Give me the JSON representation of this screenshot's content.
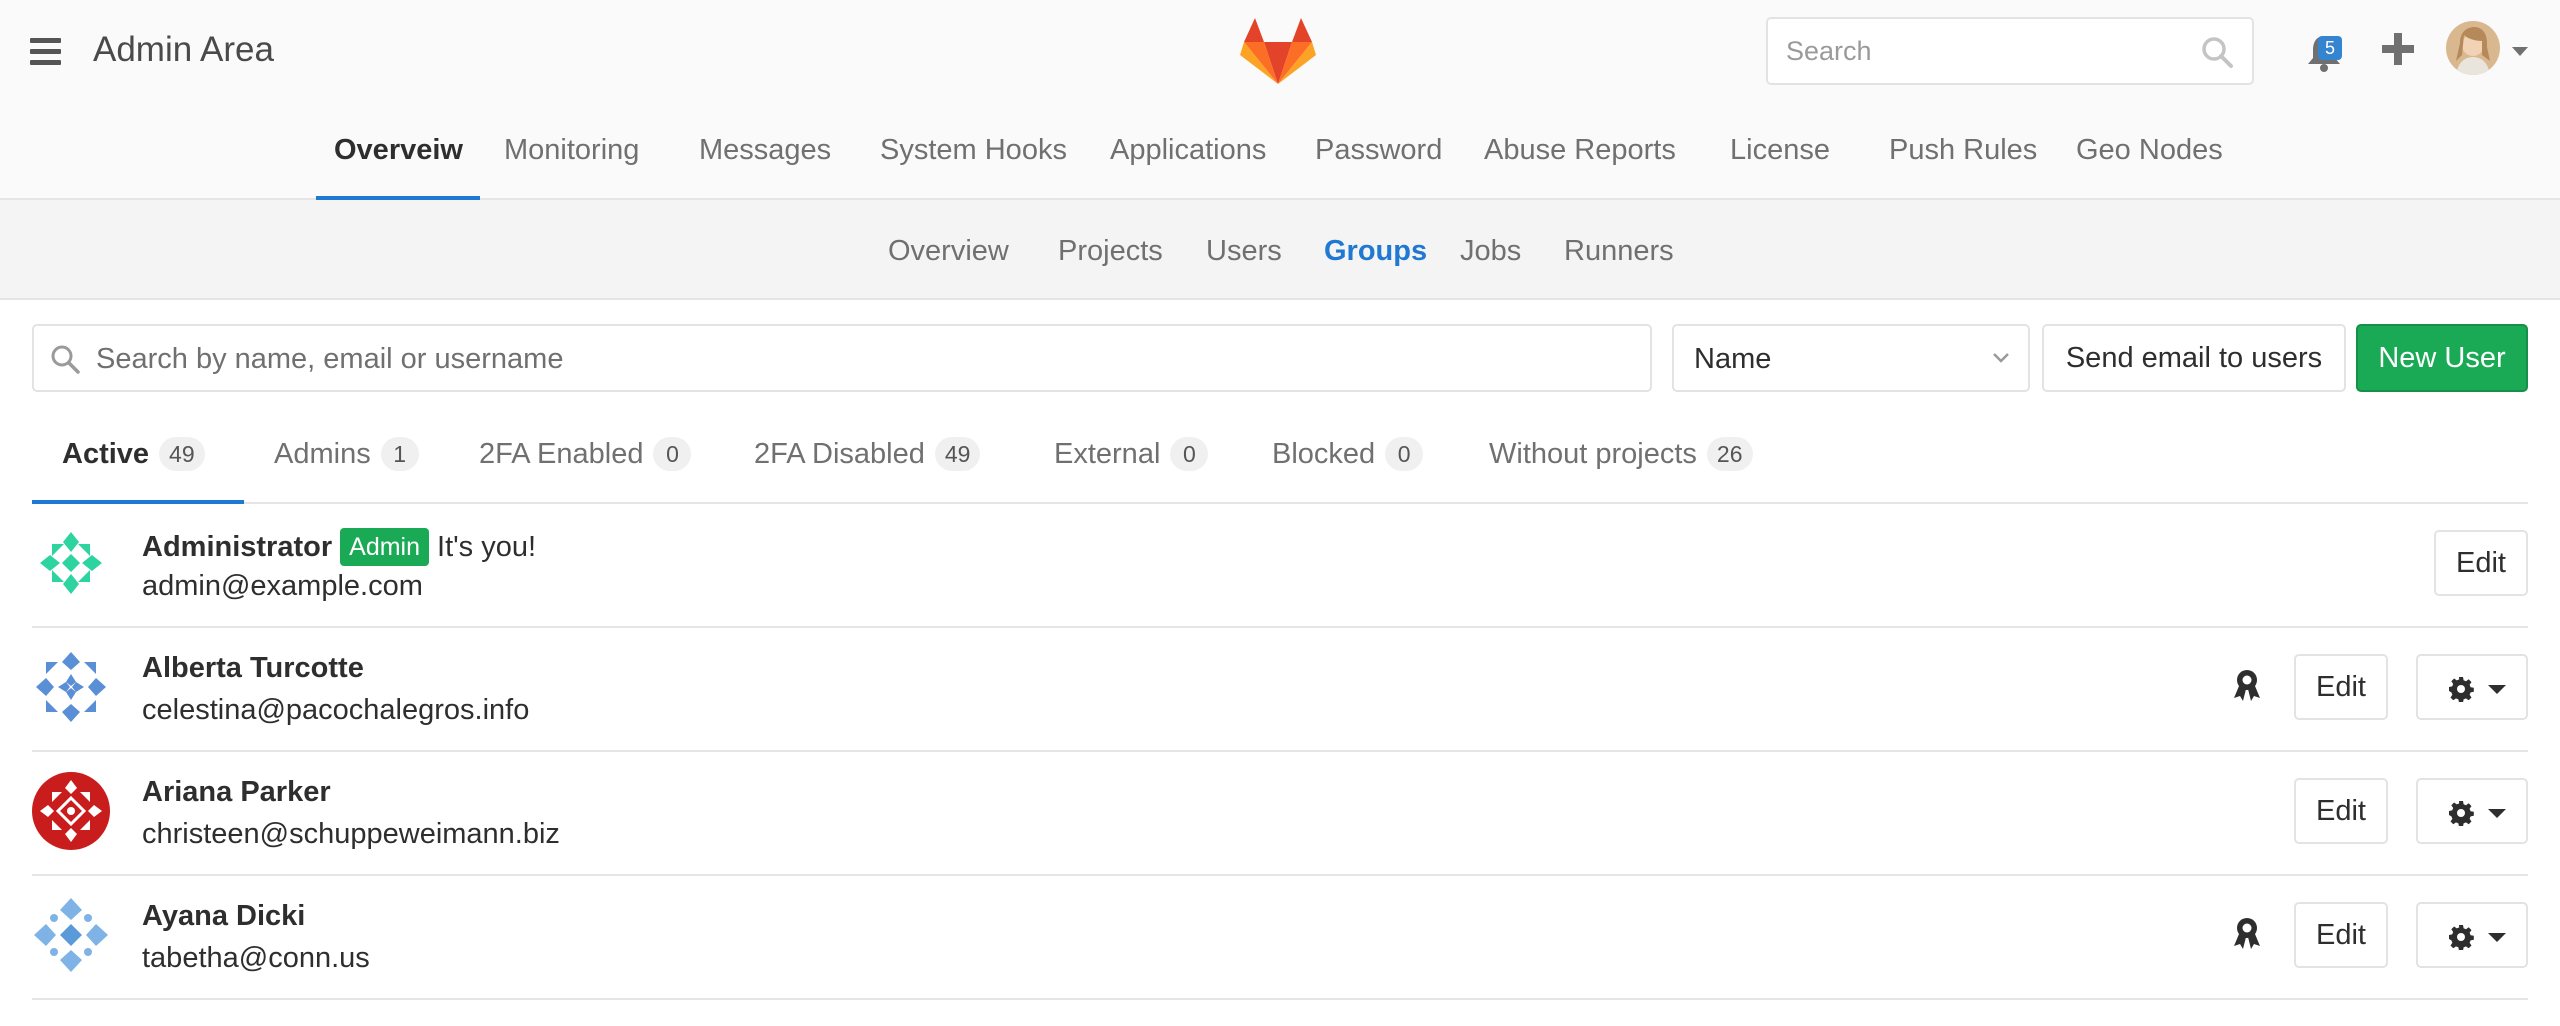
{
  "header": {
    "title": "Admin Area",
    "search_placeholder": "Search",
    "notification_count": "5"
  },
  "main_nav": {
    "tabs": [
      "Overveiw",
      "Monitoring",
      "Messages",
      "System Hooks",
      "Applications",
      "Password",
      "Abuse Reports",
      "License",
      "Push Rules",
      "Geo Nodes"
    ],
    "active": "Overveiw"
  },
  "sub_nav": {
    "tabs": [
      "Overview",
      "Projects",
      "Users",
      "Groups",
      "Jobs",
      "Runners"
    ],
    "active": "Groups"
  },
  "filters": {
    "search_placeholder": "Search by name, email or username",
    "sort_value": "Name",
    "send_email_label": "Send email to users",
    "new_user_label": "New User"
  },
  "filter_tabs": [
    {
      "label": "Active",
      "count": "49"
    },
    {
      "label": "Admins",
      "count": "1"
    },
    {
      "label": "2FA Enabled",
      "count": "0"
    },
    {
      "label": "2FA Disabled",
      "count": "49"
    },
    {
      "label": "External",
      "count": "0"
    },
    {
      "label": "Blocked",
      "count": "0"
    },
    {
      "label": "Without projects",
      "count": "26"
    }
  ],
  "users": [
    {
      "name": "Administrator",
      "badge": "Admin",
      "note": "It's you!",
      "email": "admin@example.com",
      "edit_label": "Edit"
    },
    {
      "name": "Alberta Turcotte",
      "email": "celestina@pacochalegros.info",
      "edit_label": "Edit"
    },
    {
      "name": "Ariana Parker",
      "email": "christeen@schuppeweimann.biz",
      "edit_label": "Edit"
    },
    {
      "name": "Ayana Dicki",
      "email": "tabetha@conn.us",
      "edit_label": "Edit"
    }
  ],
  "colors": {
    "accent_blue": "#1f78d1",
    "success_green": "#1aaa55",
    "notification_blue": "#3584cf"
  },
  "icons": [
    "hamburger-icon",
    "gitlab-logo",
    "search-icon",
    "bell-icon",
    "plus-icon",
    "chevron-down-icon",
    "award-icon",
    "gear-icon",
    "caret-down-icon"
  ]
}
